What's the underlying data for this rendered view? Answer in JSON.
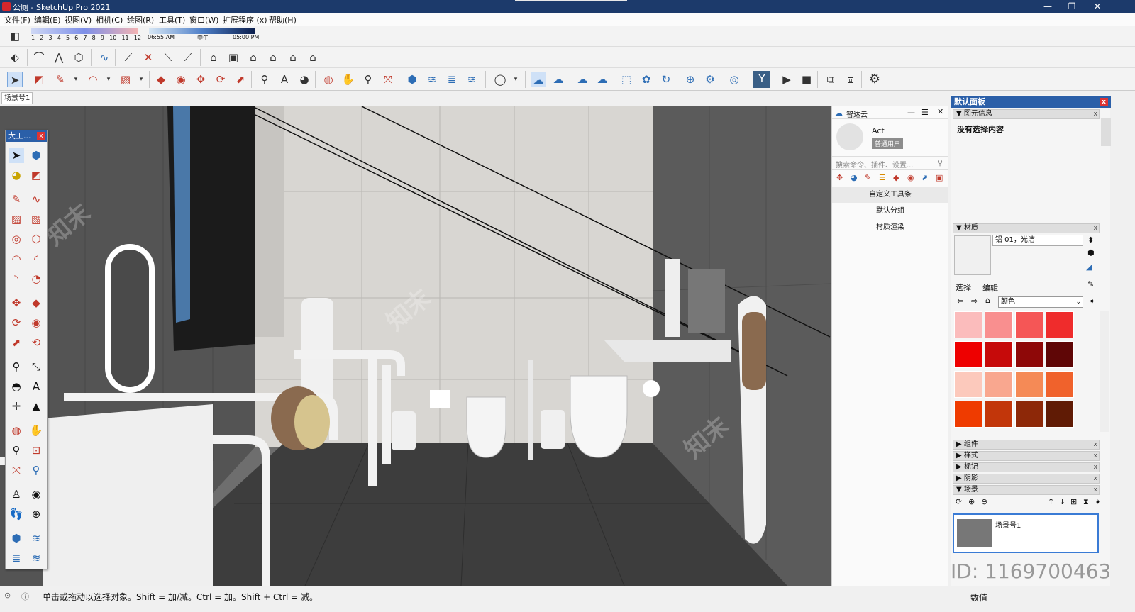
{
  "window": {
    "title": "公厕 - SketchUp Pro 2021",
    "min": "—",
    "max": "❐",
    "close": "✕"
  },
  "menu": [
    "文件(F)",
    "编辑(E)",
    "视图(V)",
    "相机(C)",
    "绘图(R)",
    "工具(T)",
    "窗口(W)",
    "扩展程序 (x)",
    "帮助(H)"
  ],
  "shadow_bar": {
    "months": [
      "1",
      "2",
      "3",
      "4",
      "5",
      "6",
      "7",
      "8",
      "9",
      "10",
      "11",
      "12"
    ],
    "time_start": "06:55 AM",
    "time_mid": "中午",
    "time_end": "05:00 PM"
  },
  "scene_tab": "场景号1",
  "largetool": {
    "title": "大工...",
    "close": "x"
  },
  "zhida": {
    "title": "智达云",
    "user_name": "Act",
    "user_role": "普通用户",
    "search_placeholder": "搜索命令、插件、设置...",
    "items": [
      "自定义工具条",
      "默认分组",
      "材质渲染"
    ]
  },
  "panel": {
    "title": "默认面板",
    "entity_info": {
      "header": "图元信息",
      "content": "没有选择内容"
    },
    "materials": {
      "header": "材质",
      "name": "铝 01，光洁",
      "tab_select": "选择",
      "tab_edit": "编辑",
      "library": "颜色",
      "colors": [
        "#fbbcbc",
        "#f98f8f",
        "#f55656",
        "#ef2c2c",
        "#ee0000",
        "#c60a0a",
        "#8e0808",
        "#5f0606",
        "#fcc9bc",
        "#f9a78f",
        "#f58a56",
        "#f0622c",
        "#ef3b00",
        "#c2360a",
        "#8d2808",
        "#601b05"
      ]
    },
    "collapsed": [
      "组件",
      "样式",
      "标记",
      "阴影"
    ],
    "scenes": {
      "header": "场景",
      "thumb_label": "场景号1"
    }
  },
  "status": {
    "message": "单击或拖动以选择对象。Shift = 加/减。Ctrl = 加。Shift + Ctrl = 减。",
    "value_label": "数值"
  },
  "watermark": {
    "id": "ID: 1169700463",
    "brand": "知末"
  }
}
